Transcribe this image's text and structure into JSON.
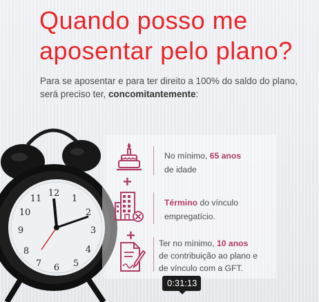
{
  "slide": {
    "title_line1": "Quando posso me",
    "title_line2": "aposentar pelo plano?",
    "intro_line1": "Para se aposentar e para ter direito a 100% do saldo do plano,",
    "intro_line2_prefix": "será preciso ter, ",
    "intro_line2_bold": "concomitantemente",
    "intro_line2_suffix": ":"
  },
  "requirements": [
    {
      "icon": "birthday-cake-icon",
      "pre": "No mínimo, ",
      "highlight": "65  anos",
      "post": "",
      "line2": "de idade"
    },
    {
      "icon": "building-cancel-icon",
      "pre": "",
      "highlight": "Término",
      "post": " do vínculo",
      "line2": "empregatício."
    },
    {
      "icon": "document-signature-icon",
      "pre": "Ter no mínimo, ",
      "highlight": "10 anos",
      "post": "",
      "line2": "de contribuição ao plano e",
      "line3": "de vínculo com a GFT."
    }
  ],
  "separator_symbol": "+",
  "video": {
    "timestamp": "0:31:13"
  },
  "colors": {
    "title_red": "#e8262b",
    "accent_burgundy": "#b03c63"
  }
}
